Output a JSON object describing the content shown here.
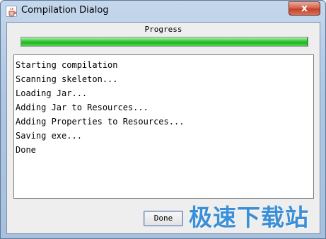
{
  "window": {
    "title": "Compilation Dialog",
    "close_label": "x"
  },
  "progress": {
    "label": "Progress",
    "fraction": 1.0
  },
  "log": {
    "lines": [
      "Starting compilation",
      "Scanning skeleton...",
      "Loading Jar...",
      "Adding Jar to Resources...",
      "Adding Properties to Resources...",
      "Saving exe...",
      "Done"
    ]
  },
  "buttons": {
    "done_label": "Done"
  },
  "watermark": {
    "text": "极速下载站"
  },
  "colors": {
    "progress_fill": "#1cb61c",
    "watermark": "#3a8fd6",
    "close_button": "#c7412a"
  },
  "icons": {
    "app": "java-cup-icon",
    "close": "close-icon"
  }
}
